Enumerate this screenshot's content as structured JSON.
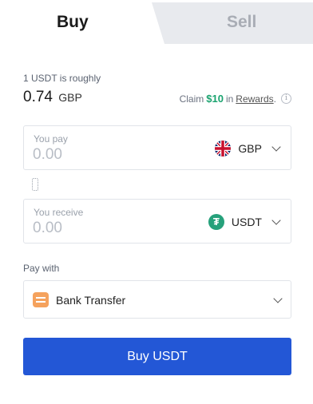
{
  "tabs": {
    "buy_label": "Buy",
    "sell_label": "Sell",
    "active": "Buy"
  },
  "rate": {
    "label": "1 USDT is roughly",
    "value": "0.74",
    "currency": "GBP"
  },
  "claim": {
    "prefix": "Claim",
    "amount": "$10",
    "middle": "in",
    "link": "Rewards",
    "suffix": ".",
    "info_icon": "info-icon"
  },
  "pay": {
    "label": "You pay",
    "placeholder": "0.00",
    "currency": "GBP",
    "icon": "uk-flag-icon"
  },
  "receive": {
    "label": "You receive",
    "placeholder": "0.00",
    "currency": "USDT",
    "icon": "tether-icon"
  },
  "pay_with": {
    "label": "Pay with",
    "method": "Bank Transfer",
    "icon": "bank-transfer-icon"
  },
  "buy_button": {
    "label": "Buy USDT"
  },
  "colors": {
    "primary": "#2357d6",
    "accent_green": "#1aa36f",
    "tether": "#26a17b",
    "bank_icon": "#f5a25d"
  }
}
